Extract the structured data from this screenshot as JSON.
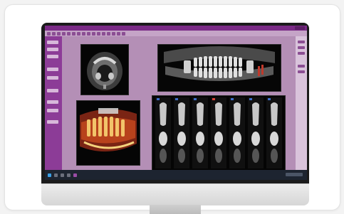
{
  "monitor": {
    "app_title": "",
    "colors": {
      "accent": "#7a2a86",
      "panel": "#8c3c97",
      "workspace": "#b48fb6",
      "taskbar": "#1d2430"
    }
  },
  "viewports": [
    {
      "name": "axial-slice",
      "kind": "CT axial"
    },
    {
      "name": "panoramic-reconstruction",
      "kind": "CT panoramic"
    },
    {
      "name": "3d-volume-render",
      "kind": "3D render"
    },
    {
      "name": "cross-sections",
      "kind": "CT cross-sections",
      "count": 7
    }
  ],
  "icons": [
    "window-controls-icon",
    "toolbar-icons",
    "taskbar-start-icon"
  ]
}
